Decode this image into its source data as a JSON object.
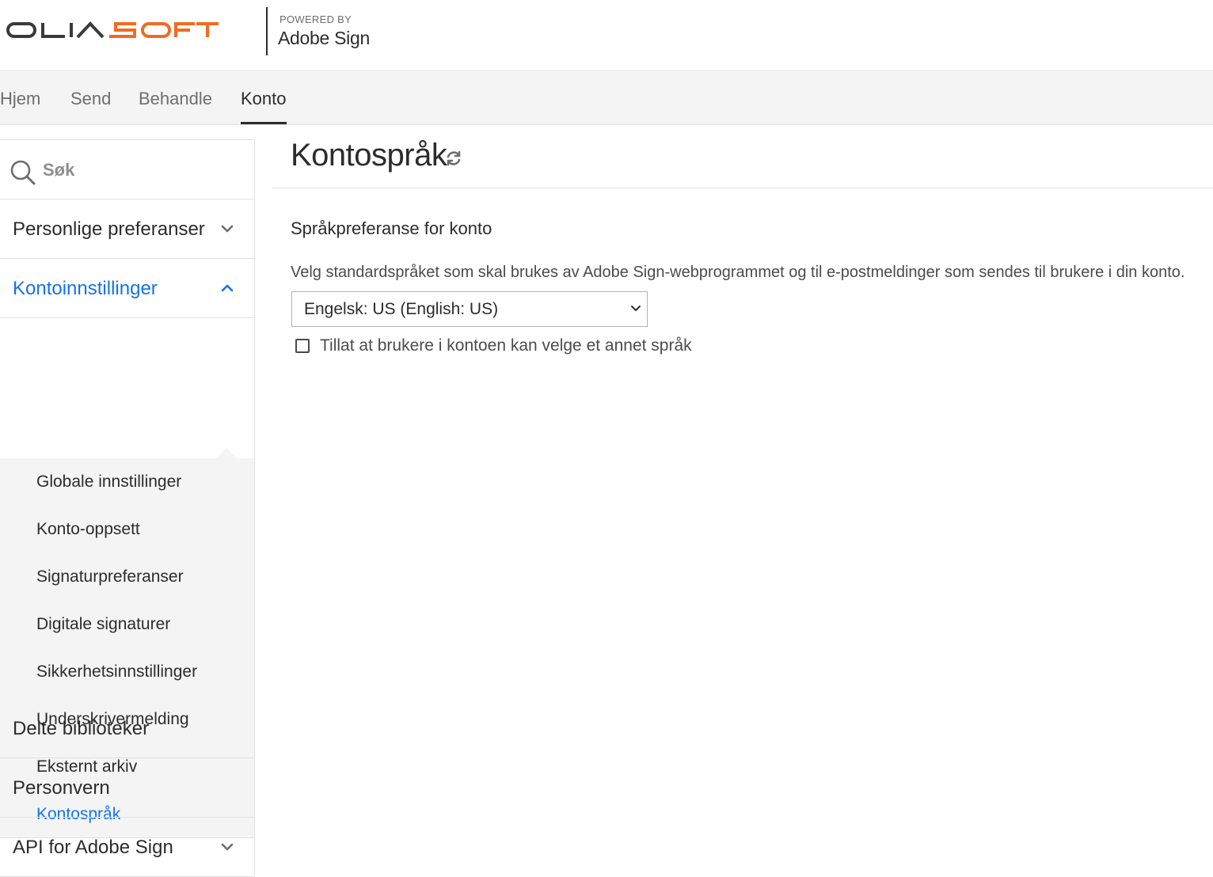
{
  "header": {
    "logo_text": "OLIASOFT",
    "powered_by": "POWERED BY",
    "product": "Adobe Sign"
  },
  "topnav": {
    "tabs": [
      {
        "label": "Hjem"
      },
      {
        "label": "Send"
      },
      {
        "label": "Behandle"
      },
      {
        "label": "Konto",
        "active": true
      }
    ]
  },
  "sidebar": {
    "search_placeholder": "Søk",
    "sections": [
      {
        "label": "Personlige preferanser",
        "state": "collapsed"
      },
      {
        "label": "Kontoinnstillinger",
        "state": "expanded"
      },
      {
        "label": "Delte biblioteker"
      },
      {
        "label": "Personvern"
      },
      {
        "label": "API for Adobe Sign",
        "state": "collapsed"
      }
    ],
    "sub_items": [
      {
        "label": "Globale innstillinger"
      },
      {
        "label": "Konto-oppsett"
      },
      {
        "label": "Signaturpreferanser"
      },
      {
        "label": "Digitale signaturer"
      },
      {
        "label": "Sikkerhetsinnstillinger"
      },
      {
        "label": "Underskrivermelding"
      },
      {
        "label": "Eksternt arkiv"
      },
      {
        "label": "Kontospråk",
        "active": true
      }
    ]
  },
  "main": {
    "title": "Kontospråk",
    "section_heading": "Språkpreferanse for konto",
    "description": "Velg standardspråket som skal brukes av Adobe Sign-webprogrammet og til e-postmeldinger som sendes til brukere i din konto.",
    "language_select": {
      "selected": "Engelsk: US (English: US)"
    },
    "allow_other_language": {
      "label": "Tillat at brukere i kontoen kan velge et annet språk",
      "checked": false
    }
  },
  "colors": {
    "accent_blue": "#1473e6",
    "logo_dark": "#3a3a3a",
    "logo_orange": "#f26b21",
    "nav_bg": "#f4f4f4"
  },
  "icons": [
    "search-icon",
    "chevron-down-icon",
    "chevron-up-icon",
    "refresh-icon",
    "dropdown-caret-icon"
  ]
}
